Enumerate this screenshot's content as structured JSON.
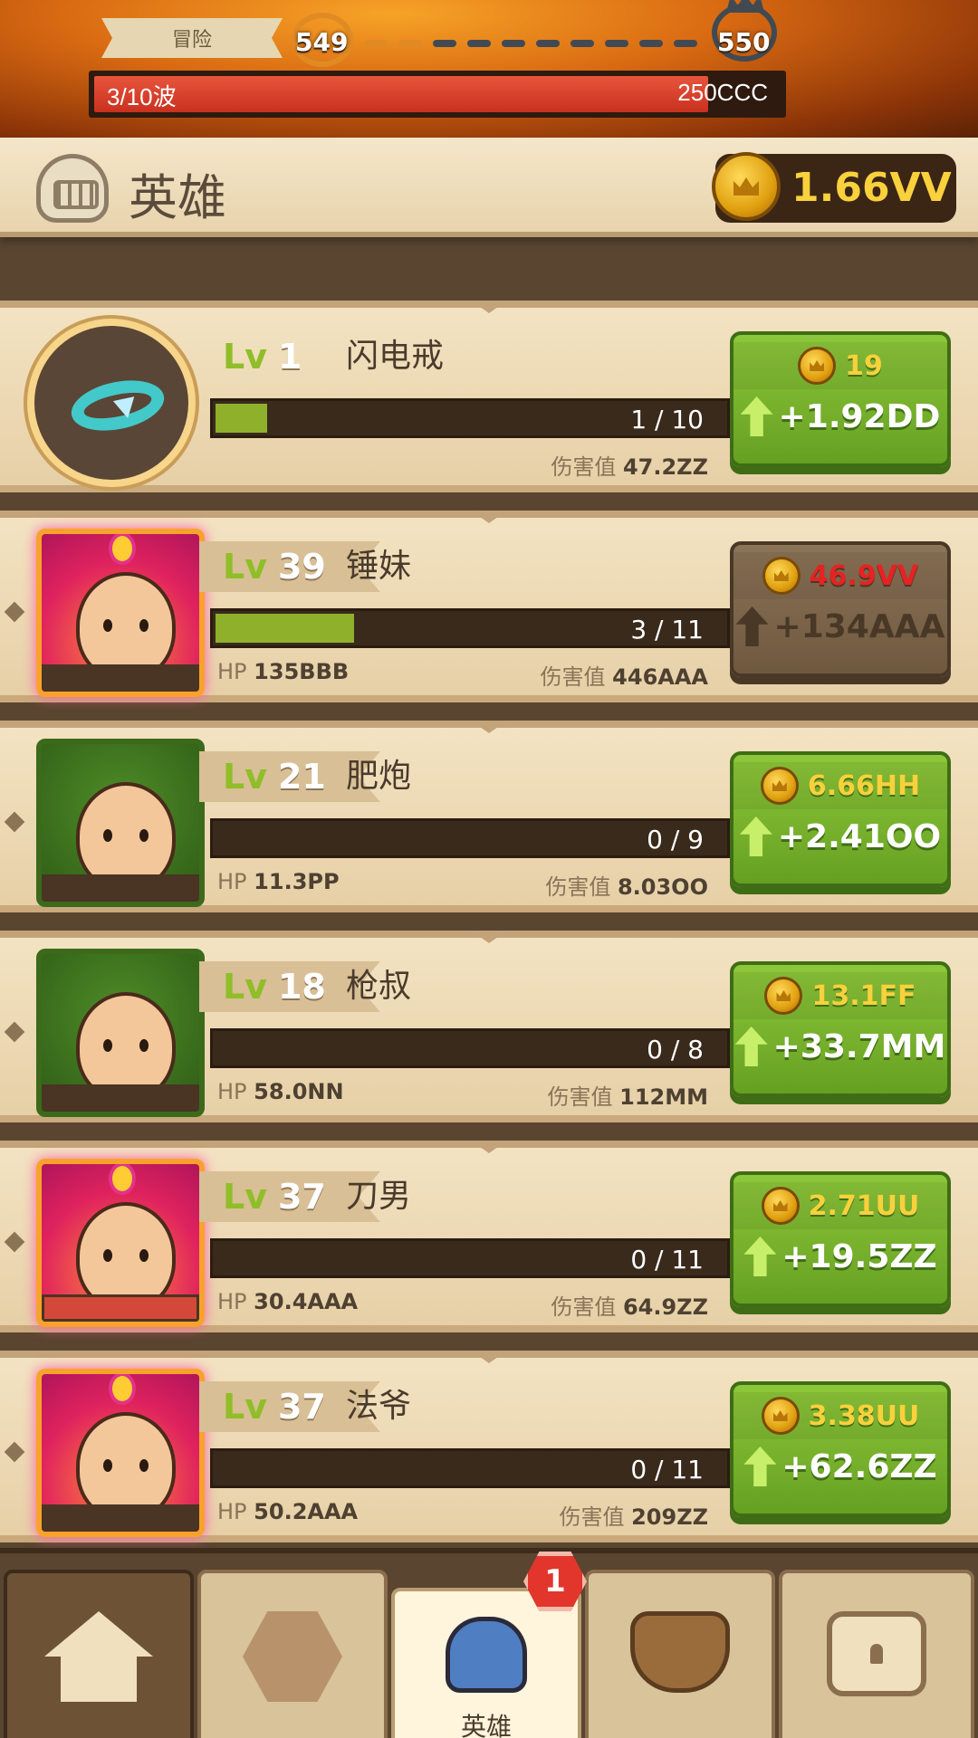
{
  "adventure": {
    "label": "冒险",
    "stage_current": "549",
    "stage_next": "550",
    "wave_text": "3/10波",
    "enemy_hp": "250CCC",
    "wave_hp_fraction": 0.88
  },
  "header": {
    "title": "英雄",
    "gold": "1.66VV"
  },
  "heroes": [
    {
      "type": "item",
      "level": "1",
      "name": "闪电戒",
      "progress": "1 / 10",
      "progress_fraction": 0.1,
      "hp": "",
      "damage_label": "伤害值",
      "damage": "47.2ZZ",
      "cost": "19",
      "gain": "+1.92DD",
      "affordable": true
    },
    {
      "type": "hero",
      "frame": "legend",
      "level": "39",
      "name": "锤妹",
      "progress": "3 / 11",
      "progress_fraction": 0.27,
      "hp_label": "HP",
      "hp": "135BBB",
      "damage_label": "伤害值",
      "damage": "446AAA",
      "cost": "46.9VV",
      "gain": "+134AAA",
      "affordable": false
    },
    {
      "type": "hero",
      "frame": "green",
      "level": "21",
      "name": "肥炮",
      "progress": "0 / 9",
      "progress_fraction": 0,
      "hp_label": "HP",
      "hp": "11.3PP",
      "damage_label": "伤害值",
      "damage": "8.03OO",
      "cost": "6.66HH",
      "gain": "+2.41OO",
      "affordable": true
    },
    {
      "type": "hero",
      "frame": "green",
      "level": "18",
      "name": "枪叔",
      "progress": "0 / 8",
      "progress_fraction": 0,
      "hp_label": "HP",
      "hp": "58.0NN",
      "damage_label": "伤害值",
      "damage": "112MM",
      "cost": "13.1FF",
      "gain": "+33.7MM",
      "affordable": true
    },
    {
      "type": "hero",
      "frame": "legend",
      "level": "37",
      "name": "刀男",
      "progress": "0 / 11",
      "progress_fraction": 0,
      "hp_label": "HP",
      "hp": "30.4AAA",
      "damage_label": "伤害值",
      "damage": "64.9ZZ",
      "cost": "2.71UU",
      "gain": "+19.5ZZ",
      "affordable": true
    },
    {
      "type": "hero",
      "frame": "legend",
      "level": "37",
      "name": "法爷",
      "progress": "0 / 11",
      "progress_fraction": 0,
      "hp_label": "HP",
      "hp": "50.2AAA",
      "damage_label": "伤害值",
      "damage": "209ZZ",
      "cost": "3.38UU",
      "gain": "+62.6ZZ",
      "affordable": true
    }
  ],
  "level_prefix": "Lv",
  "nav": {
    "tabs": [
      {
        "icon": "camp-icon",
        "label": ""
      },
      {
        "icon": "rune-icon",
        "label": ""
      },
      {
        "icon": "hero-helmet-icon",
        "label": "英雄"
      },
      {
        "icon": "cauldron-icon",
        "label": ""
      },
      {
        "icon": "treasure-chest-icon",
        "label": ""
      }
    ],
    "badge": "1"
  },
  "colors": {
    "upgrade_green": "#7bb52e",
    "upgrade_disabled": "#7a6249",
    "gold_text": "#f8d13c",
    "cost_unaffordable": "#e62222",
    "level_green": "#8fbe28"
  }
}
